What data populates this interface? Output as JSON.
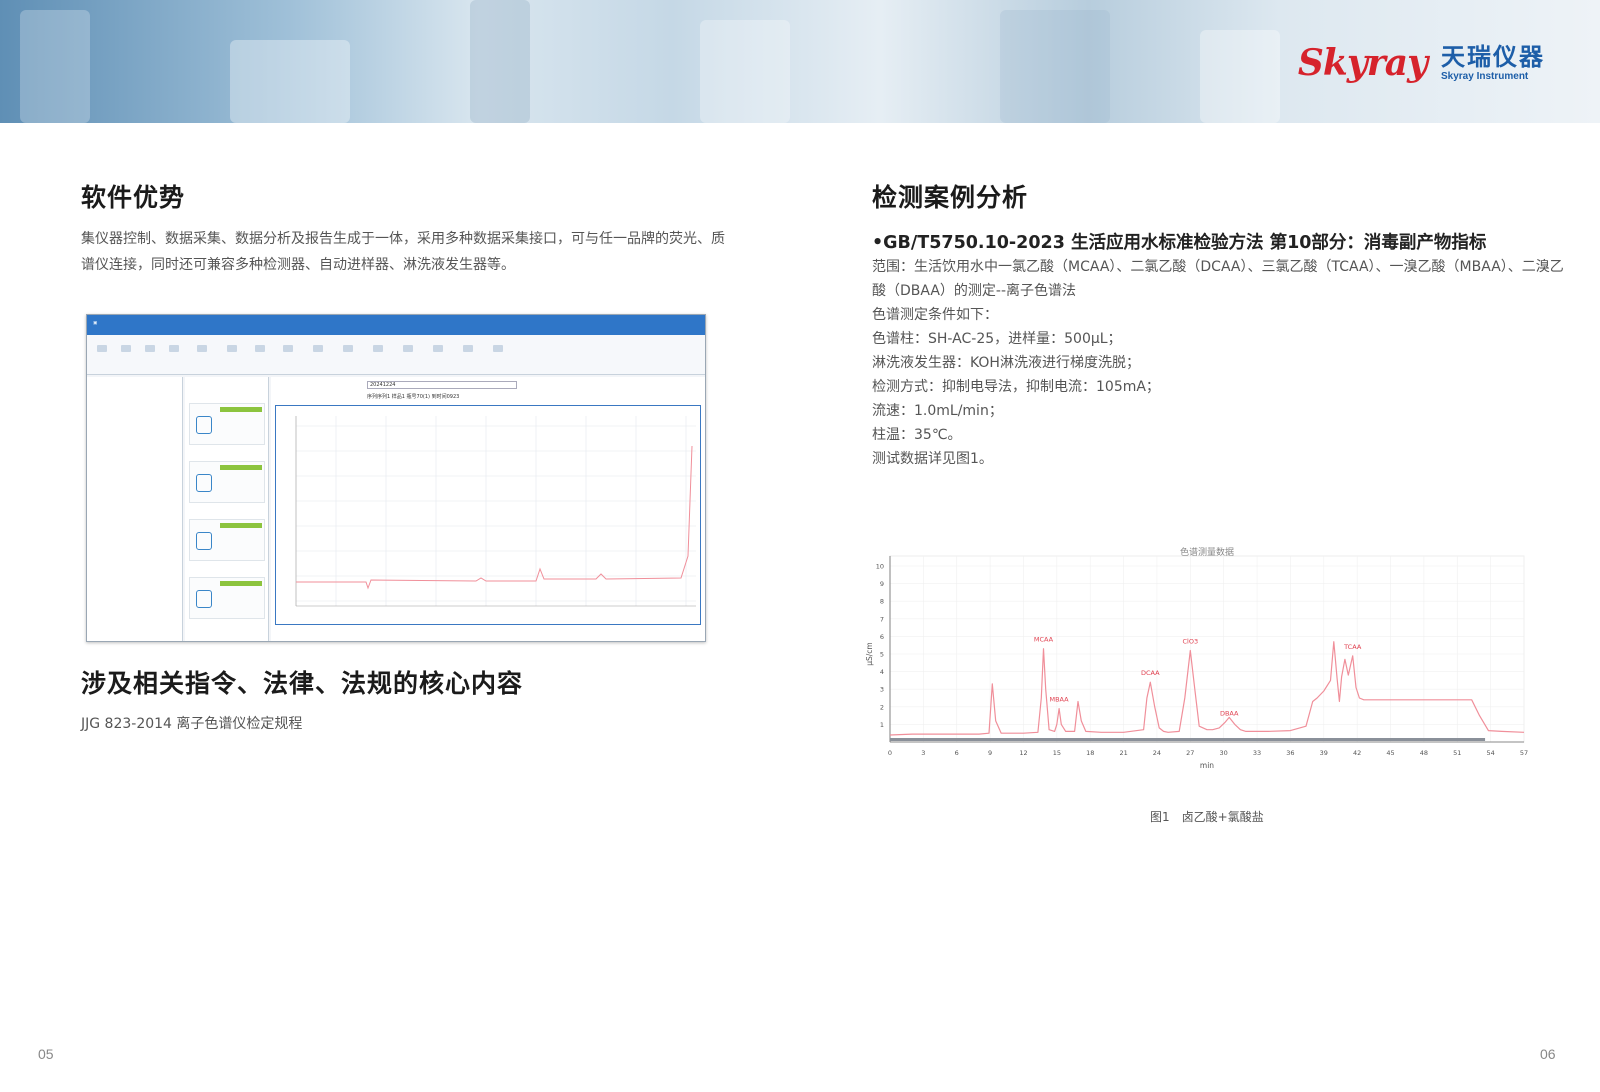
{
  "brand": {
    "script": "Skyray",
    "name_cn": "天瑞仪器",
    "name_en": "Skyray Instrument"
  },
  "left": {
    "heading": "软件优势",
    "intro_line1": "集仪器控制、数据采集、数据分析及报告生成于一体，采用多种数据采集接口，可与任一品牌的荧光、质",
    "intro_line2": "谱仪连接，同时还可兼容多种检测器、自动进样器、淋洗液发生器等。",
    "software": {
      "sample_value": "20241224",
      "info": "序列序列1  样品1  瓶号70(1)  到时间0923"
    },
    "regulation_heading": "涉及相关指令、法律、法规的核心内容",
    "regulation_text": "JJG 823-2014 离子色谱仪检定规程",
    "page_number": "05"
  },
  "right": {
    "heading": "检测案例分析",
    "standard_title": "•GB/T5750.10-2023 生活应用水标准检验方法 第10部分：消毒副产物指标",
    "conditions": [
      "范围：生活饮用水中一氯乙酸（MCAA）、二氯乙酸（DCAA）、三氯乙酸（TCAA）、一溴乙酸（MBAA）、二溴乙",
      "酸（DBAA）的测定--离子色谱法",
      "色谱测定条件如下：",
      "色谱柱：SH-AC-25，进样量：500μL；",
      "淋洗液发生器：KOH淋洗液进行梯度洗脱；",
      "检测方式：抑制电导法，抑制电流：105mA；",
      "流速：1.0mL/min；",
      "柱温：35℃。",
      "测试数据详见图1。"
    ],
    "figure_caption": "图1　卤乙酸+氯酸盐",
    "page_number": "06"
  },
  "chart_data": {
    "type": "line",
    "title": "色谱测量数据",
    "xlabel": "min",
    "ylabel": "μS/cm",
    "xlim": [
      0,
      57
    ],
    "ylim": [
      0,
      10
    ],
    "xticks": [
      0,
      3,
      6,
      9,
      12,
      15,
      18,
      21,
      24,
      27,
      30,
      33,
      36,
      39,
      42,
      45,
      48,
      51,
      54,
      57
    ],
    "yticks": [
      1,
      2,
      3,
      4,
      5,
      6,
      7,
      8,
      9,
      10
    ],
    "line_color": "#f08f9a",
    "grid": true,
    "peaks": [
      {
        "name": "MCAA",
        "x": 13.8,
        "y": 5.3
      },
      {
        "name": "MBAA",
        "x": 15.2,
        "y": 1.9
      },
      {
        "name": "DCAA",
        "x": 23.4,
        "y": 3.4
      },
      {
        "name": "ClO3",
        "x": 27.0,
        "y": 5.2
      },
      {
        "name": "DBAA",
        "x": 30.5,
        "y": 1.1
      },
      {
        "name": "TCAA",
        "x": 41.6,
        "y": 4.9
      }
    ],
    "x": [
      0,
      2,
      4,
      6,
      8,
      8.9,
      9.2,
      9.5,
      10,
      12,
      13.3,
      13.6,
      13.8,
      14.0,
      14.3,
      14.8,
      15.0,
      15.2,
      15.4,
      15.8,
      16.6,
      16.9,
      17.2,
      17.6,
      19,
      21,
      22.8,
      23.1,
      23.4,
      23.8,
      24.2,
      24.6,
      25,
      26,
      26.5,
      27.0,
      27.4,
      27.8,
      28.5,
      29,
      29.6,
      30.1,
      30.5,
      31.0,
      31.5,
      32,
      34,
      36,
      37.4,
      38.0,
      38.4,
      39.0,
      39.6,
      39.9,
      40.2,
      40.4,
      40.6,
      40.9,
      41.2,
      41.6,
      41.9,
      42.2,
      42.6,
      43.5,
      46,
      50,
      52.3,
      53.0,
      53.8,
      55,
      57
    ],
    "y": [
      0.4,
      0.45,
      0.45,
      0.45,
      0.45,
      0.5,
      3.3,
      1.2,
      0.5,
      0.5,
      0.55,
      2.5,
      5.3,
      3.0,
      0.7,
      0.6,
      1.0,
      1.9,
      1.0,
      0.6,
      0.6,
      2.3,
      1.2,
      0.6,
      0.55,
      0.55,
      0.7,
      2.5,
      3.4,
      2.0,
      0.8,
      0.6,
      0.55,
      0.6,
      2.5,
      5.2,
      3.0,
      0.9,
      0.7,
      0.7,
      0.8,
      1.1,
      1.4,
      1.0,
      0.7,
      0.6,
      0.6,
      0.65,
      0.9,
      2.3,
      2.5,
      2.9,
      3.5,
      5.7,
      3.6,
      2.3,
      3.7,
      4.7,
      3.8,
      4.9,
      3.1,
      2.5,
      2.4,
      2.4,
      2.4,
      2.4,
      2.4,
      1.5,
      0.65,
      0.6,
      0.55
    ]
  }
}
